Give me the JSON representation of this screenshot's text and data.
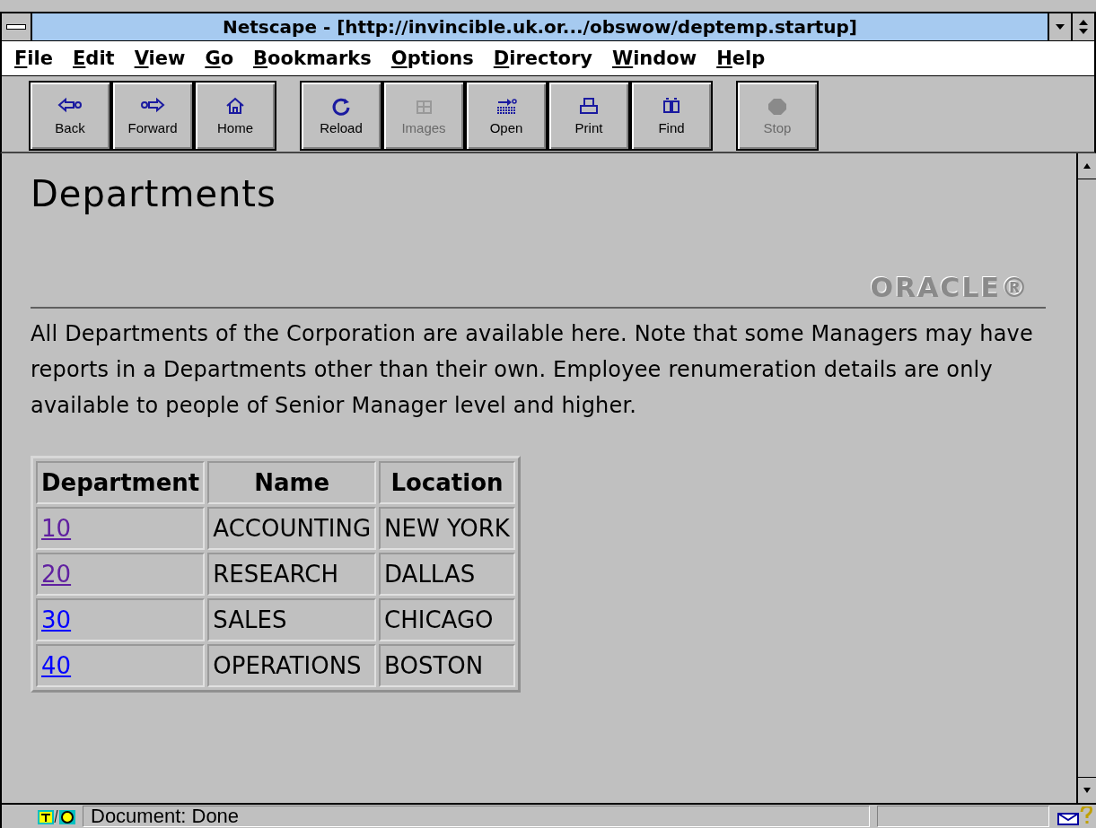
{
  "window": {
    "title": "Netscape - [http://invincible.uk.or.../obswow/deptemp.startup]"
  },
  "menu": [
    "File",
    "Edit",
    "View",
    "Go",
    "Bookmarks",
    "Options",
    "Directory",
    "Window",
    "Help"
  ],
  "toolbar": [
    {
      "kind": "back",
      "label": "Back",
      "disabled": false
    },
    {
      "kind": "forward",
      "label": "Forward",
      "disabled": false
    },
    {
      "kind": "home",
      "label": "Home",
      "disabled": false
    },
    {
      "kind": "reload",
      "label": "Reload",
      "disabled": false
    },
    {
      "kind": "images",
      "label": "Images",
      "disabled": true
    },
    {
      "kind": "open",
      "label": "Open",
      "disabled": false
    },
    {
      "kind": "print",
      "label": "Print",
      "disabled": false
    },
    {
      "kind": "find",
      "label": "Find",
      "disabled": false
    },
    {
      "kind": "stop",
      "label": "Stop",
      "disabled": true
    }
  ],
  "page": {
    "heading": "Departments",
    "logo": "ORACLE®",
    "intro": "All Departments of the Corporation are available here. Note that some Managers may have reports in a Departments other than their own. Employee renumeration details are only available to people of Senior Manager level and higher.",
    "table": {
      "columns": [
        "Department",
        "Name",
        "Location"
      ],
      "rows": [
        {
          "department": "10",
          "visited": true,
          "name": "ACCOUNTING",
          "location": "NEW YORK"
        },
        {
          "department": "20",
          "visited": true,
          "name": "RESEARCH",
          "location": "DALLAS"
        },
        {
          "department": "30",
          "visited": false,
          "name": "SALES",
          "location": "CHICAGO"
        },
        {
          "department": "40",
          "visited": false,
          "name": "OPERATIONS",
          "location": "BOSTON"
        }
      ]
    }
  },
  "status_bar": {
    "text": "Document: Done"
  }
}
